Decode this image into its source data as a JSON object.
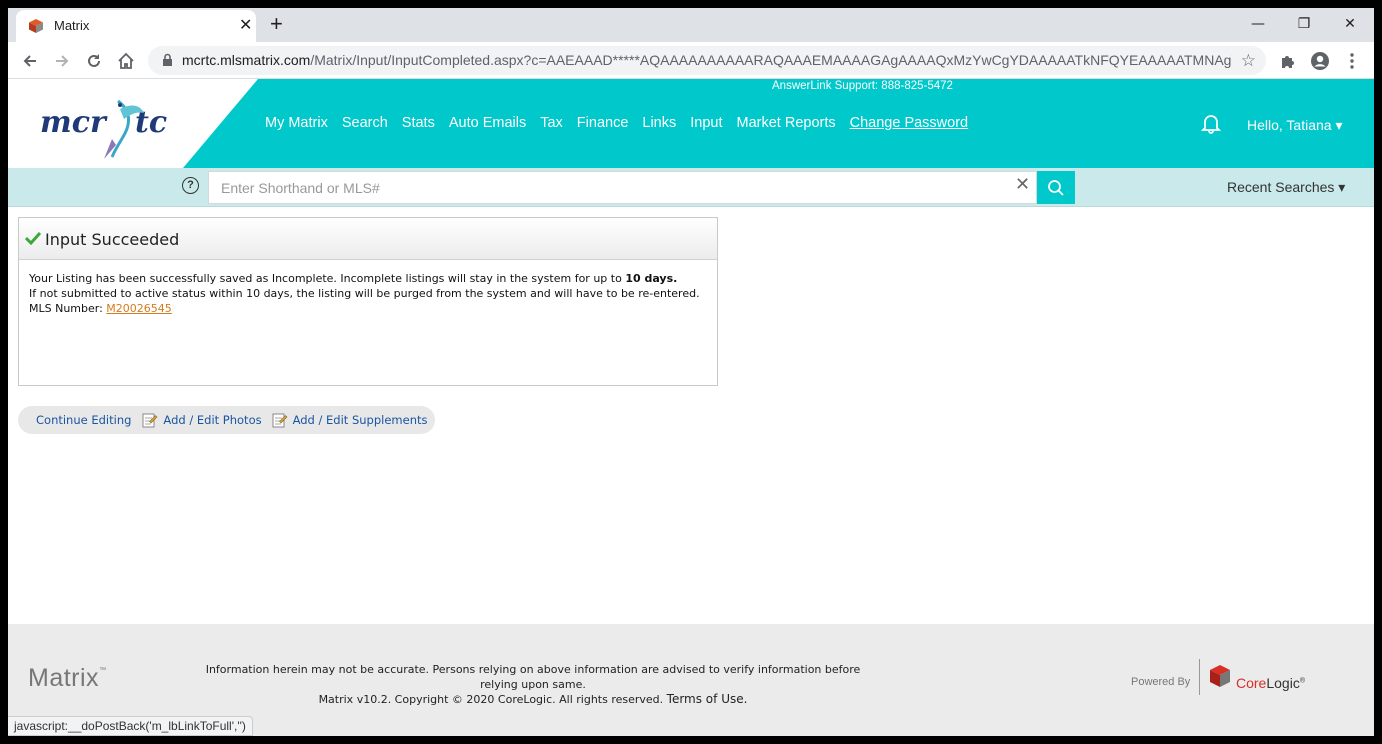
{
  "browser": {
    "tab_title": "Matrix",
    "tab_close": "✕",
    "new_tab": "+",
    "url_host": "mcrtc.mlsmatrix.com",
    "url_path": "/Matrix/Input/InputCompleted.aspx?c=AAEAAAD*****AQAAAAAAAAAARAQAAAEMAAAAGAgAAAAQxMzYwCgYDAAAAATkNFQYEAAAAATMNAgYF...",
    "win_minimize": "—",
    "win_restore": "❐",
    "win_close": "✕",
    "star": "☆"
  },
  "header": {
    "logo_left": "mcr",
    "logo_right": "tc",
    "support": "AnswerLink Support: 888-825-5472",
    "nav": [
      {
        "label": "My Matrix"
      },
      {
        "label": "Search"
      },
      {
        "label": "Stats"
      },
      {
        "label": "Auto Emails"
      },
      {
        "label": "Tax"
      },
      {
        "label": "Finance"
      },
      {
        "label": "Links"
      },
      {
        "label": "Input"
      },
      {
        "label": "Market Reports"
      },
      {
        "label": "Change Password"
      }
    ],
    "greeting": "Hello, Tatiana",
    "dropdown_caret": "▾"
  },
  "search": {
    "help": "?",
    "placeholder": "Enter Shorthand or MLS#",
    "clear": "✕",
    "recent": "Recent Searches",
    "recent_caret": "▾"
  },
  "panel": {
    "title": "Input Succeeded",
    "line1_a": "Your Listing has been successfully saved as Incomplete. Incomplete listings will stay in the system for up to ",
    "line1_b": "10 days.",
    "line2": "If not submitted to active status within 10 days, the listing will be purged from the system and will have to be re-entered.",
    "mls_label": "MLS Number: ",
    "mls_number": "M20026545"
  },
  "actions": {
    "continue": "Continue Editing",
    "photos": "Add / Edit Photos",
    "supplements": "Add / Edit Supplements"
  },
  "footer": {
    "brand": "Matrix",
    "tm": "™",
    "line1": "Information herein may not be accurate. Persons relying on above information are advised to verify information before relying upon same.",
    "line2": "Matrix v10.2. Copyright © 2020 CoreLogic. All rights reserved.",
    "terms": "Terms of Use.",
    "powered_by": "Powered By",
    "corelogic_a": "Core",
    "corelogic_b": "Logic",
    "reg": "®"
  },
  "status_bar": "javascript:__doPostBack('m_lbLinkToFull','')",
  "colors": {
    "brand_teal": "#01c8cb",
    "search_band": "#c9e9ea",
    "link_orange": "#d77a1c",
    "link_blue": "#1a55a0",
    "corelogic_red": "#d92f27"
  }
}
